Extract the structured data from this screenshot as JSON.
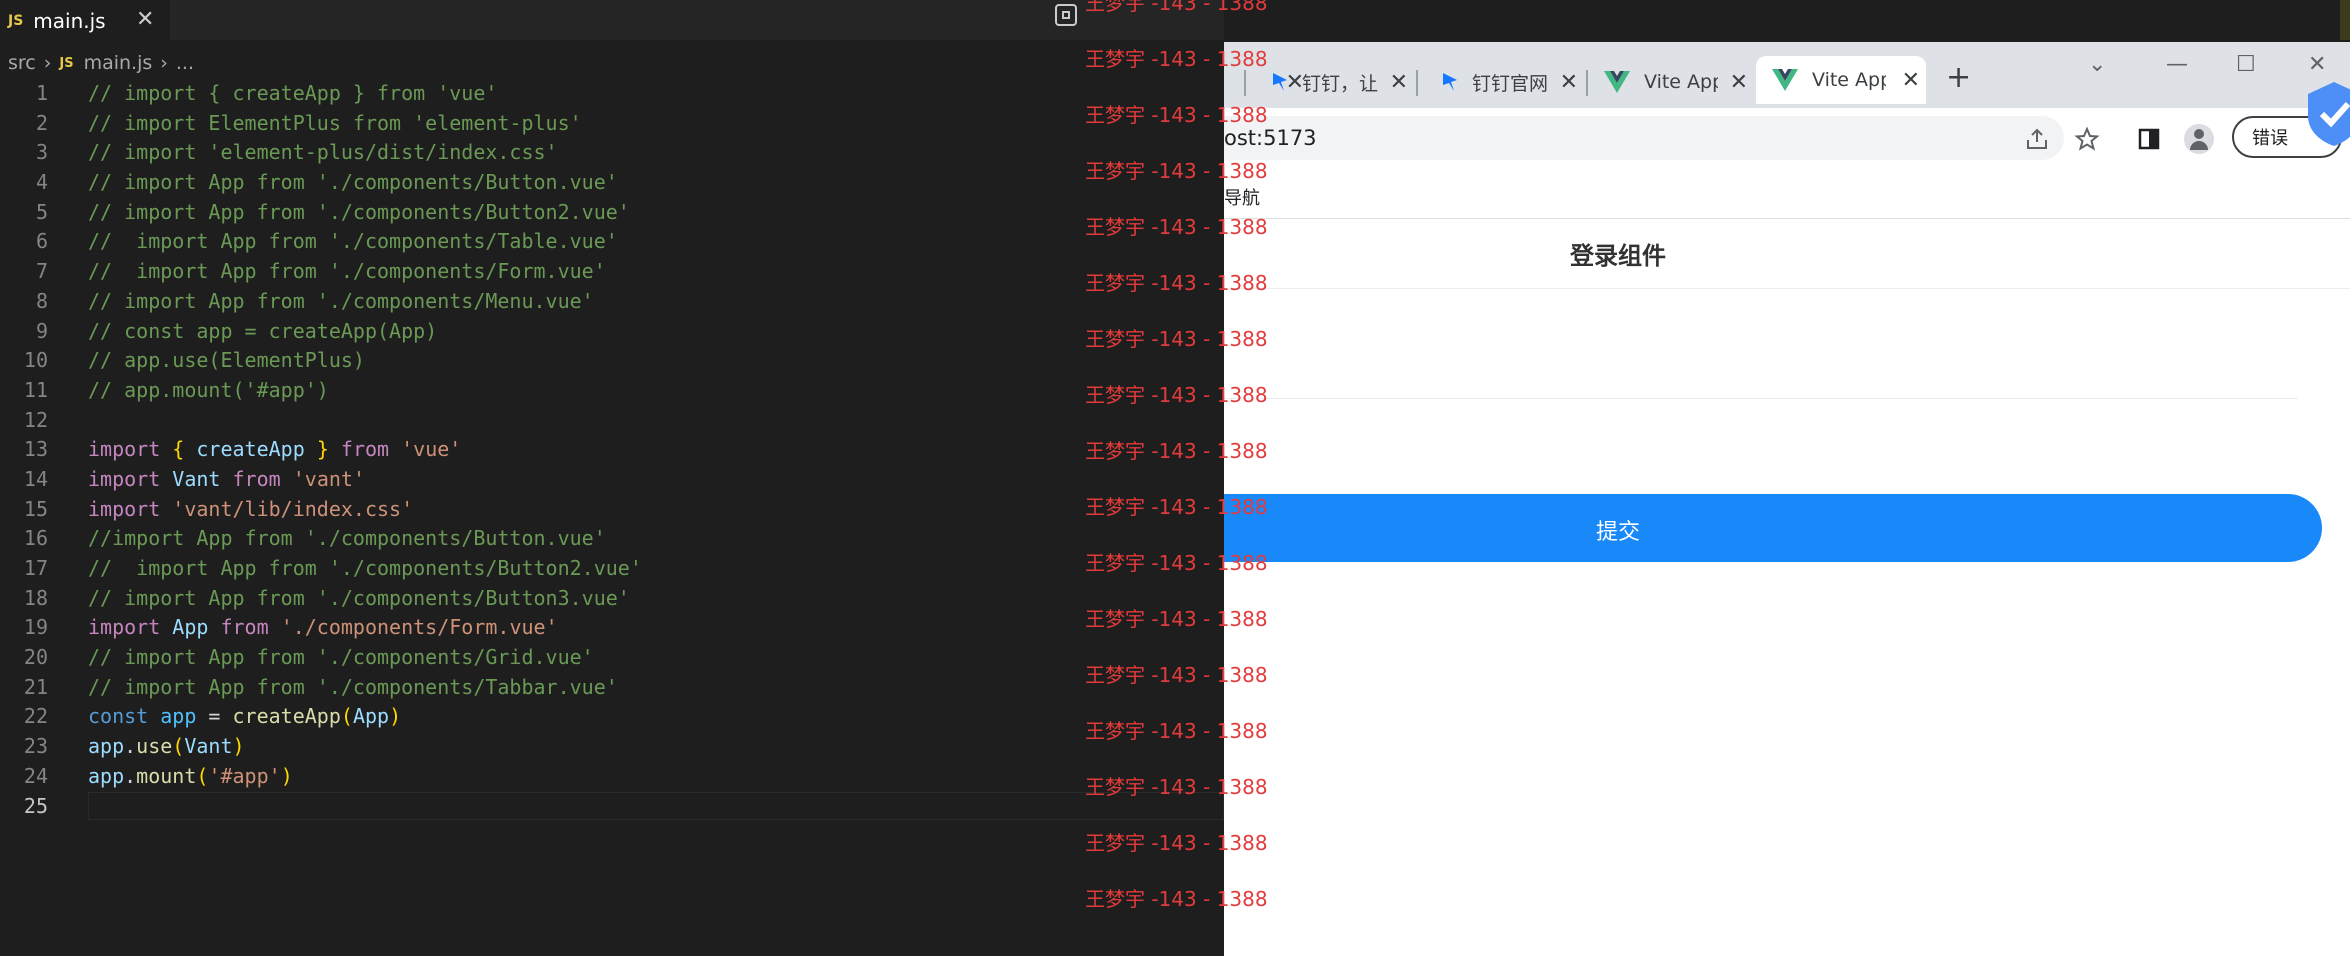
{
  "editor": {
    "tab": {
      "badge": "JS",
      "title": "main.js",
      "close": "✕"
    },
    "breadcrumb": {
      "folder": "src",
      "badge": "JS",
      "file": "main.js",
      "more": "..."
    },
    "lines": [
      {
        "n": "1",
        "parts": [
          [
            "cm",
            "// import { createApp } from 'vue'"
          ]
        ]
      },
      {
        "n": "2",
        "parts": [
          [
            "cm",
            "// import ElementPlus from 'element-plus'"
          ]
        ]
      },
      {
        "n": "3",
        "parts": [
          [
            "cm",
            "// import 'element-plus/dist/index.css'"
          ]
        ]
      },
      {
        "n": "4",
        "parts": [
          [
            "cm",
            "// import App from './components/Button.vue'"
          ]
        ]
      },
      {
        "n": "5",
        "parts": [
          [
            "cm",
            "// import App from './components/Button2.vue'"
          ]
        ]
      },
      {
        "n": "6",
        "parts": [
          [
            "cm",
            "//  import App from './components/Table.vue'"
          ]
        ]
      },
      {
        "n": "7",
        "parts": [
          [
            "cm",
            "//  import App from './components/Form.vue'"
          ]
        ]
      },
      {
        "n": "8",
        "parts": [
          [
            "cm",
            "// import App from './components/Menu.vue'"
          ]
        ]
      },
      {
        "n": "9",
        "parts": [
          [
            "cm",
            "// const app = createApp(App)"
          ]
        ]
      },
      {
        "n": "10",
        "parts": [
          [
            "cm",
            "// app.use(ElementPlus)"
          ]
        ]
      },
      {
        "n": "11",
        "parts": [
          [
            "cm",
            "// app.mount('#app')"
          ]
        ]
      },
      {
        "n": "12",
        "parts": []
      },
      {
        "n": "13",
        "parts": [
          [
            "kw",
            "import"
          ],
          [
            "pn",
            " "
          ],
          [
            "br",
            "{"
          ],
          [
            "pn",
            " "
          ],
          [
            "var",
            "createApp"
          ],
          [
            "pn",
            " "
          ],
          [
            "br",
            "}"
          ],
          [
            "pn",
            " "
          ],
          [
            "kw",
            "from"
          ],
          [
            "pn",
            " "
          ],
          [
            "str",
            "'vue'"
          ]
        ]
      },
      {
        "n": "14",
        "parts": [
          [
            "kw",
            "import"
          ],
          [
            "pn",
            " "
          ],
          [
            "var",
            "Vant"
          ],
          [
            "pn",
            " "
          ],
          [
            "kw",
            "from"
          ],
          [
            "pn",
            " "
          ],
          [
            "str",
            "'vant'"
          ]
        ]
      },
      {
        "n": "15",
        "parts": [
          [
            "kw",
            "import"
          ],
          [
            "pn",
            " "
          ],
          [
            "str",
            "'vant/lib/index.css'"
          ]
        ]
      },
      {
        "n": "16",
        "parts": [
          [
            "cm",
            "//import App from './components/Button.vue'"
          ]
        ]
      },
      {
        "n": "17",
        "parts": [
          [
            "cm",
            "//  import App from './components/Button2.vue'"
          ]
        ]
      },
      {
        "n": "18",
        "parts": [
          [
            "cm",
            "// import App from './components/Button3.vue'"
          ]
        ]
      },
      {
        "n": "19",
        "parts": [
          [
            "kw",
            "import"
          ],
          [
            "pn",
            " "
          ],
          [
            "var",
            "App"
          ],
          [
            "pn",
            " "
          ],
          [
            "kw",
            "from"
          ],
          [
            "pn",
            " "
          ],
          [
            "str",
            "'./components/Form.vue'"
          ]
        ]
      },
      {
        "n": "20",
        "parts": [
          [
            "cm",
            "// import App from './components/Grid.vue'"
          ]
        ]
      },
      {
        "n": "21",
        "parts": [
          [
            "cm",
            "// import App from './components/Tabbar.vue'"
          ]
        ]
      },
      {
        "n": "22",
        "parts": [
          [
            "decl",
            "const"
          ],
          [
            "pn",
            " "
          ],
          [
            "cls",
            "app"
          ],
          [
            "pn",
            " = "
          ],
          [
            "fn",
            "createApp"
          ],
          [
            "br",
            "("
          ],
          [
            "var",
            "App"
          ],
          [
            "br",
            ")"
          ]
        ]
      },
      {
        "n": "23",
        "parts": [
          [
            "var",
            "app"
          ],
          [
            "pn",
            "."
          ],
          [
            "fn",
            "use"
          ],
          [
            "br",
            "("
          ],
          [
            "var",
            "Vant"
          ],
          [
            "br",
            ")"
          ]
        ]
      },
      {
        "n": "24",
        "parts": [
          [
            "var",
            "app"
          ],
          [
            "pn",
            "."
          ],
          [
            "fn",
            "mount"
          ],
          [
            "br",
            "("
          ],
          [
            "str",
            "'#app'"
          ],
          [
            "br",
            ")"
          ]
        ]
      },
      {
        "n": "25",
        "parts": []
      }
    ]
  },
  "watermark": {
    "text": "王梦宇 -143 - 1388",
    "count": 17
  },
  "browser": {
    "tabs": [
      {
        "label": "钉钉，让",
        "icon": "dingtalk-icon",
        "close": "✕"
      },
      {
        "label": "钉钉官网",
        "icon": "dingtalk-icon",
        "close": "✕"
      },
      {
        "label": "Vite App",
        "icon": "vue-icon",
        "close": "✕"
      },
      {
        "label": "Vite App",
        "icon": "vue-icon",
        "close": "✕",
        "active": true
      }
    ],
    "new_tab": "+",
    "win": {
      "dropdown": "⌄",
      "minimize": "—",
      "maximize": "☐",
      "close": "✕"
    },
    "url": "ost:5173",
    "error_button": "错误",
    "bookmark": "导航",
    "page": {
      "nav_title": "登录组件",
      "submit": "提交"
    },
    "colors": {
      "primary": "#1989fa",
      "vue_green": "#41b883",
      "ding_blue": "#1677ff"
    }
  }
}
